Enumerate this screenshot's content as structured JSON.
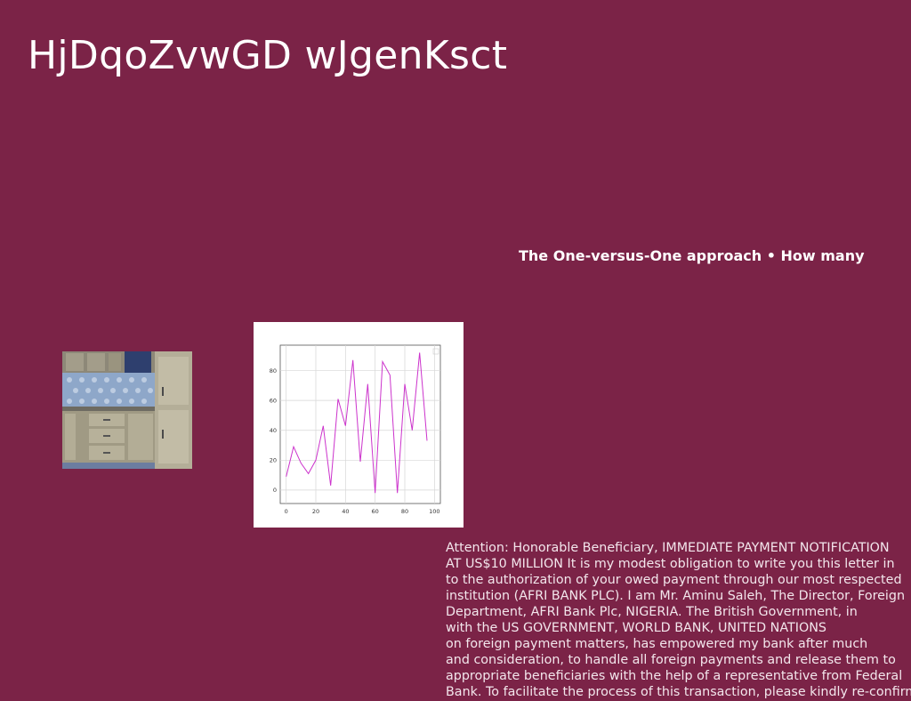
{
  "page": {
    "title": "HjDqoZvwGD wJgenKsct",
    "subtitle": "The One-versus-One approach • How many",
    "background_color": "#7b2347"
  },
  "photo": {
    "description_name": "kitchen-cabinets-photo"
  },
  "chart_data": {
    "type": "line",
    "title": "",
    "xlabel": "",
    "ylabel": "",
    "x": [
      0,
      5,
      10,
      15,
      20,
      25,
      30,
      35,
      40,
      45,
      50,
      55,
      60,
      65,
      70,
      75,
      80,
      85,
      90,
      95,
      100
    ],
    "series": [
      {
        "color": "#cc33cc",
        "values": [
          9,
          29,
          18,
          11,
          20,
          43,
          3,
          61,
          43,
          87,
          19,
          71,
          -2,
          86,
          77,
          -2,
          71,
          40,
          92,
          33
        ]
      }
    ],
    "xlim": [
      -4,
      104
    ],
    "ylim": [
      -9,
      97
    ],
    "xticks": [
      "0",
      "20",
      "40",
      "60",
      "80",
      "100"
    ],
    "yticks": [
      "0",
      "20",
      "40",
      "60",
      "80"
    ],
    "grid": true
  },
  "body": {
    "lines": [
      "Attention: Honorable Beneficiary, IMMEDIATE PAYMENT NOTIFICATION",
      "AT US$10 MILLION It is my modest obligation to write you this letter in",
      "to the authorization of your owed payment through our most respected",
      "institution (AFRI BANK PLC). I am Mr. Aminu Saleh, The Director, Foreign",
      "Department, AFRI Bank Plc, NIGERIA. The British Government, in",
      "with the US GOVERNMENT, WORLD BANK, UNITED NATIONS",
      "on foreign payment matters, has empowered my bank after much",
      "and consideration, to handle all foreign payments and release them to",
      "appropriate beneficiaries with the help of a representative from Federal",
      "Bank. To facilitate the process of this transaction, please kindly re-confirm"
    ]
  }
}
